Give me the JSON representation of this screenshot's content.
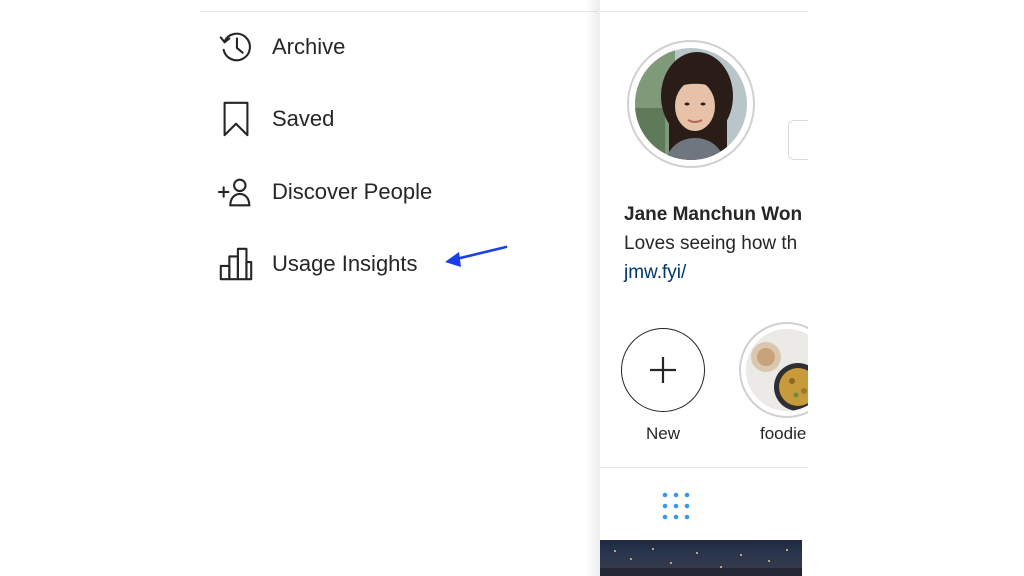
{
  "menu": {
    "items": [
      {
        "label": "Archive",
        "icon": "archive-clock-icon"
      },
      {
        "label": "Saved",
        "icon": "bookmark-icon"
      },
      {
        "label": "Discover People",
        "icon": "add-person-icon"
      },
      {
        "label": "Usage Insights",
        "icon": "bar-chart-icon"
      }
    ],
    "annotation_arrow_color": "#1a3ee8"
  },
  "profile": {
    "name": "Jane Manchun Won",
    "bio": "Loves seeing how th",
    "link": "jmw.fyi/",
    "link_color": "#00376b"
  },
  "highlights": [
    {
      "label": "New",
      "icon": "plus-icon"
    },
    {
      "label": "foodie"
    }
  ],
  "tabs": {
    "grid_icon": "grid-icon",
    "grid_color": "#3897f0"
  }
}
